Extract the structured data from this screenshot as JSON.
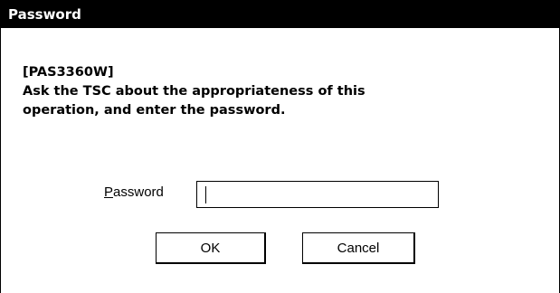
{
  "window": {
    "title": "Password"
  },
  "message": {
    "code": "[PAS3360W]",
    "line1": "Ask the TSC about the appropriateness of this",
    "line2": "operation, and enter the password."
  },
  "password_field": {
    "label_accel": "P",
    "label_rest": "assword",
    "value": ""
  },
  "buttons": {
    "ok_label": "OK",
    "cancel_label": "Cancel"
  }
}
